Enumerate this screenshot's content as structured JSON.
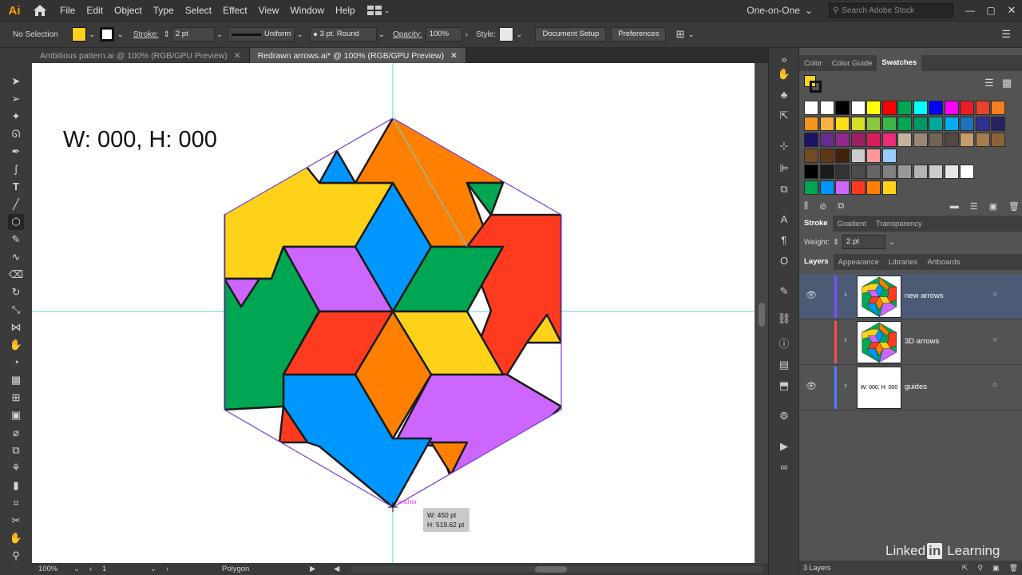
{
  "app": {
    "logo": "Ai"
  },
  "menu": [
    "File",
    "Edit",
    "Object",
    "Type",
    "Select",
    "Effect",
    "View",
    "Window",
    "Help"
  ],
  "workspace": {
    "label": "One-on-One",
    "search_placeholder": "Search Adobe Stock"
  },
  "control": {
    "selection_label": "No Selection",
    "stroke_label": "Stroke:",
    "stroke_value": "2 pt",
    "uniform_label": "Uniform",
    "brush_label": "3 pt. Round",
    "opacity_label": "Opacity:",
    "opacity_value": "100%",
    "style_label": "Style:",
    "doc_setup": "Document Setup",
    "preferences": "Preferences"
  },
  "tabs": [
    {
      "label": "Ambitious pattern.ai @ 100% (RGB/GPU Preview)"
    },
    {
      "label": "Redrawn arrows.ai* @ 100% (RGB/GPU Preview)"
    }
  ],
  "canvas": {
    "big_text": "W: 000, H: 000",
    "anchor_label": "anchor",
    "tooltip_w": "W: 450 pt",
    "tooltip_h": "H: 519.62 pt"
  },
  "status": {
    "zoom": "100%",
    "artboard": "1",
    "tool": "Polygon"
  },
  "color_panel": {
    "tabs": [
      "Color",
      "Color Guide",
      "Swatches"
    ],
    "active": "Swatches",
    "fill_color": "#ffd21a",
    "swatch_rows": [
      [
        "#ffffff",
        "#ffffff",
        "#000000",
        "#ffffff",
        "#ffff00",
        "#ff0000",
        "#00a651",
        "#00ffff",
        "#0000ff",
        "#ff00ff",
        "#e81f25",
        "#e9422d",
        "#f57e20"
      ],
      [
        "#f7941d",
        "#fbb040",
        "#ffde17",
        "#d7df23",
        "#8dc63f",
        "#39b54a",
        "#00a651",
        "#009966",
        "#00a99d",
        "#00aeef",
        "#1c75bc",
        "#2e3192",
        "#262262"
      ],
      [
        "#1b1464",
        "#662d91",
        "#92278f",
        "#9e1f63",
        "#da1c5c",
        "#ee2a7b",
        "#c2b59b",
        "#998675",
        "#736357",
        "#534741",
        "#c69c6d",
        "#a67c52",
        "#8c6239"
      ],
      [
        "#754c24",
        "#603913",
        "#42210b",
        "#cccccc",
        "#ff9999",
        "#99ccff"
      ],
      [
        "#000000",
        "#1a1a1a",
        "#333333",
        "#4d4d4d",
        "#666666",
        "#808080",
        "#999999",
        "#b3b3b3",
        "#cccccc",
        "#e6e6e6",
        "#ffffff"
      ],
      [
        "#00a651",
        "#0096ff",
        "#cc66ff",
        "#ff3b1f",
        "#ff8000",
        "#ffd21a"
      ]
    ]
  },
  "stroke_panel": {
    "tabs": [
      "Stroke",
      "Gradient",
      "Transparency"
    ],
    "weight_label": "Weight:",
    "weight_value": "2 pt"
  },
  "layers_panel": {
    "tabs": [
      "Layers",
      "Appearance",
      "Libraries",
      "Artboards"
    ],
    "layers": [
      {
        "name": "new arrows",
        "color": "#7b4fff",
        "selected": true
      },
      {
        "name": "3D arrows",
        "color": "#ff4d4d",
        "selected": false
      },
      {
        "name": "guides",
        "color": "#4d7bff",
        "selected": false,
        "thumb_text": "W: 000, H: 000"
      }
    ],
    "count": "3 Layers"
  },
  "watermark": "Linked in Learning"
}
